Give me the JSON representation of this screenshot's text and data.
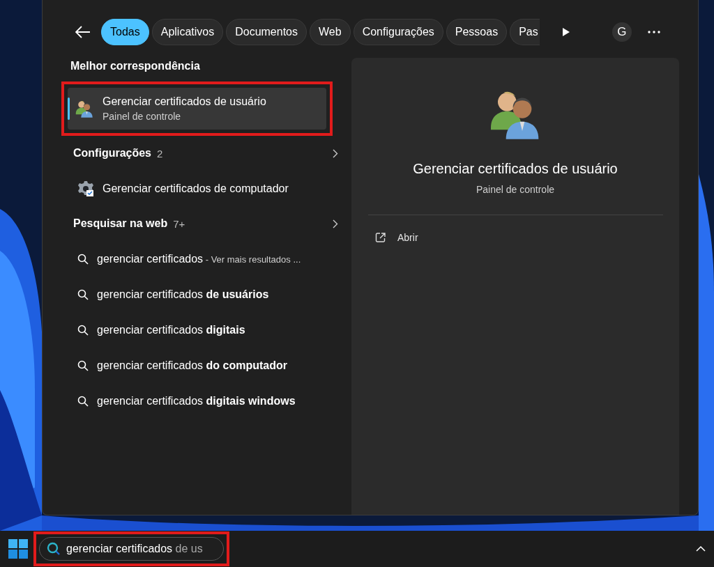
{
  "tabs": [
    {
      "label": "Todas",
      "selected": true
    },
    {
      "label": "Aplicativos",
      "selected": false
    },
    {
      "label": "Documentos",
      "selected": false
    },
    {
      "label": "Web",
      "selected": false
    },
    {
      "label": "Configurações",
      "selected": false
    },
    {
      "label": "Pessoas",
      "selected": false
    },
    {
      "label": "Pas",
      "selected": false
    }
  ],
  "account": {
    "initial": "G"
  },
  "best_match": {
    "heading": "Melhor correspondência",
    "title": "Gerenciar certificados de usuário",
    "subtitle": "Painel de controle",
    "selected": true,
    "highlighted": true
  },
  "sections": [
    {
      "heading": "Configurações",
      "count": "2",
      "items": [
        {
          "kind": "setting",
          "text": "Gerenciar certificados de computador",
          "selected": false
        }
      ]
    },
    {
      "heading": "Pesquisar na web",
      "count": "7+",
      "items": [
        {
          "kind": "web",
          "text": "gerenciar certificados",
          "suffix": "- Ver mais resultados ...",
          "selected": false
        },
        {
          "kind": "web",
          "text": "gerenciar certificados **de usuários**",
          "selected": false
        },
        {
          "kind": "web",
          "text": "gerenciar certificados **digitais**",
          "selected": false
        },
        {
          "kind": "web",
          "text": "gerenciar certificados **do computador**",
          "selected": false
        },
        {
          "kind": "web",
          "text": "gerenciar certificados **digitais windows**",
          "selected": false
        }
      ]
    }
  ],
  "preview": {
    "title": "Gerenciar certificados de usuário",
    "subtitle": "Painel de controle",
    "actions": [
      {
        "label": "Abrir"
      }
    ]
  },
  "taskbar": {
    "search": {
      "value": "gerenciar certificados",
      "completion": "de us",
      "highlighted": true
    }
  }
}
